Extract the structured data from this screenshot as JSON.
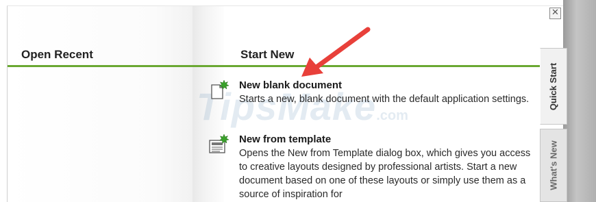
{
  "sections": {
    "recent_heading": "Open Recent",
    "start_heading": "Start New"
  },
  "entries": [
    {
      "title": "New blank document",
      "description": "Starts a new, blank document with the default application settings.",
      "icon": "new-blank-document-icon"
    },
    {
      "title": "New from template",
      "description": "Opens the New from Template dialog box, which gives you access to creative layouts designed by professional artists. Start a new document based on one of these layouts or simply use them as a source of inspiration for",
      "icon": "new-from-template-icon"
    }
  ],
  "tabs": {
    "quick_start": "Quick Start",
    "whats_new": "What's New"
  },
  "close_label": "✕",
  "watermark": {
    "text": "TipsMake",
    "suffix": ".com"
  },
  "colors": {
    "accent_rule": "#6aa832",
    "annotation_arrow": "#e8403a",
    "starburst": "#3aa12b"
  }
}
